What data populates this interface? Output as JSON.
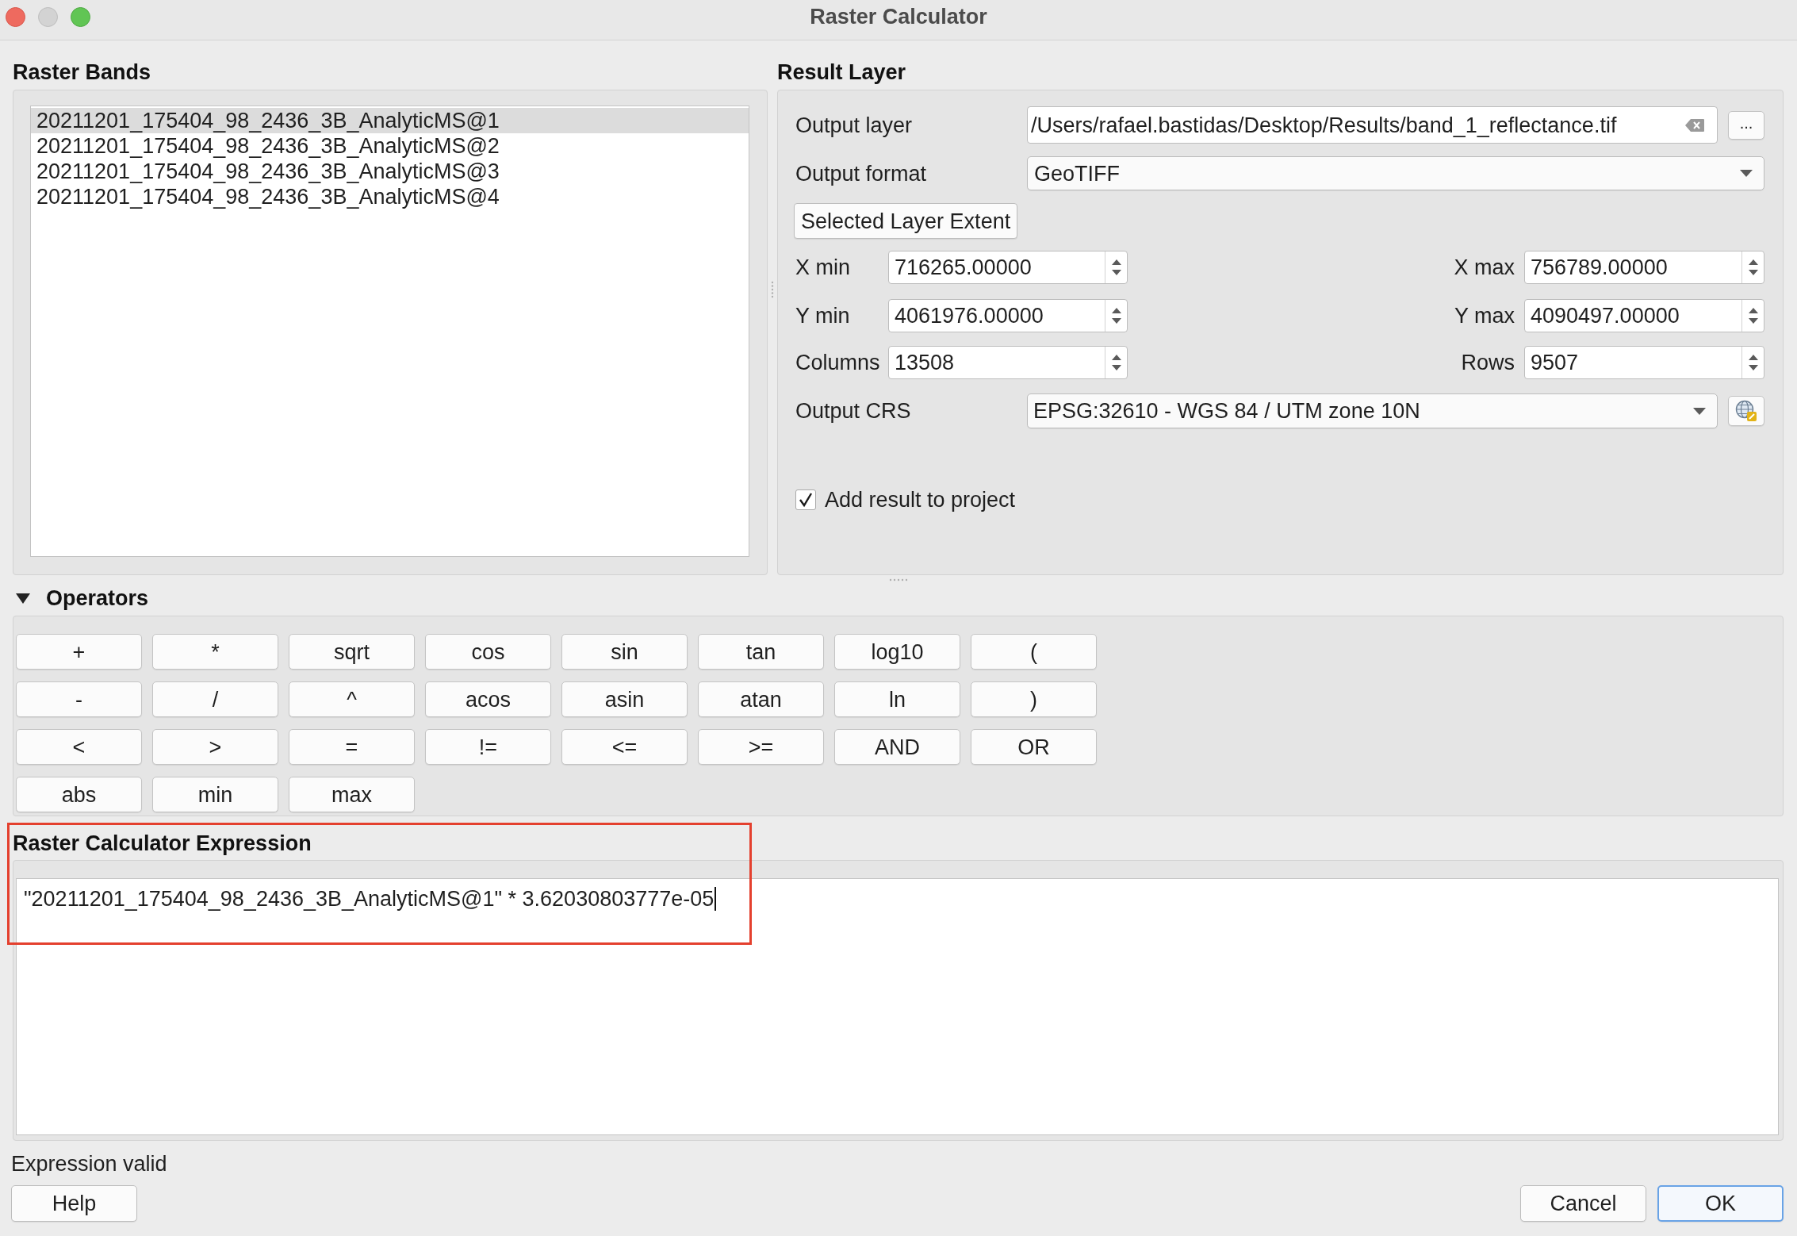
{
  "window": {
    "title": "Raster Calculator",
    "controls": [
      {
        "kind": "close",
        "disabled": false
      },
      {
        "kind": "minimize",
        "disabled": true
      },
      {
        "kind": "zoom",
        "disabled": false
      }
    ]
  },
  "raster_bands": {
    "title": "Raster Bands",
    "items": [
      {
        "label": "20211201_175404_98_2436_3B_AnalyticMS@1",
        "selected": true
      },
      {
        "label": "20211201_175404_98_2436_3B_AnalyticMS@2",
        "selected": false
      },
      {
        "label": "20211201_175404_98_2436_3B_AnalyticMS@3",
        "selected": false
      },
      {
        "label": "20211201_175404_98_2436_3B_AnalyticMS@4",
        "selected": false
      }
    ]
  },
  "result_layer": {
    "title": "Result Layer",
    "output_layer": {
      "label": "Output layer",
      "value": "/Users/rafael.bastidas/Desktop/Results/band_1_reflectance.tif",
      "browse_button": "..."
    },
    "output_format": {
      "label": "Output format",
      "value": "GeoTIFF"
    },
    "extent_button": "Selected Layer Extent",
    "extent_fields": [
      {
        "label": "X min",
        "value": "716265.00000"
      },
      {
        "label": "X max",
        "value": "756789.00000"
      },
      {
        "label": "Y min",
        "value": "4061976.00000"
      },
      {
        "label": "Y max",
        "value": "4090497.00000"
      },
      {
        "label": "Columns",
        "value": "13508"
      },
      {
        "label": "Rows",
        "value": "9507"
      }
    ],
    "output_crs": {
      "label": "Output CRS",
      "value": "EPSG:32610 - WGS 84 / UTM zone 10N"
    },
    "add_to_project": {
      "label": "Add result to project",
      "checked": true
    }
  },
  "operators": {
    "title": "Operators",
    "expanded": true,
    "buttons": [
      "+",
      "*",
      "sqrt",
      "cos",
      "sin",
      "tan",
      "log10",
      "(",
      "-",
      "/",
      "^",
      "acos",
      "asin",
      "atan",
      "ln",
      ")",
      "<",
      ">",
      "=",
      "!=",
      "<=",
      ">=",
      "AND",
      "OR",
      "abs",
      "min",
      "max"
    ]
  },
  "expression": {
    "title": "Raster Calculator Expression",
    "value": "\"20211201_175404_98_2436_3B_AnalyticMS@1\" * 3.62030803777e-05",
    "highlighted": true
  },
  "status": "Expression valid",
  "footer": {
    "left_buttons": [
      {
        "label": "Help",
        "default": false
      }
    ],
    "right_buttons": [
      {
        "label": "Cancel",
        "default": false
      },
      {
        "label": "OK",
        "default": true
      }
    ]
  }
}
